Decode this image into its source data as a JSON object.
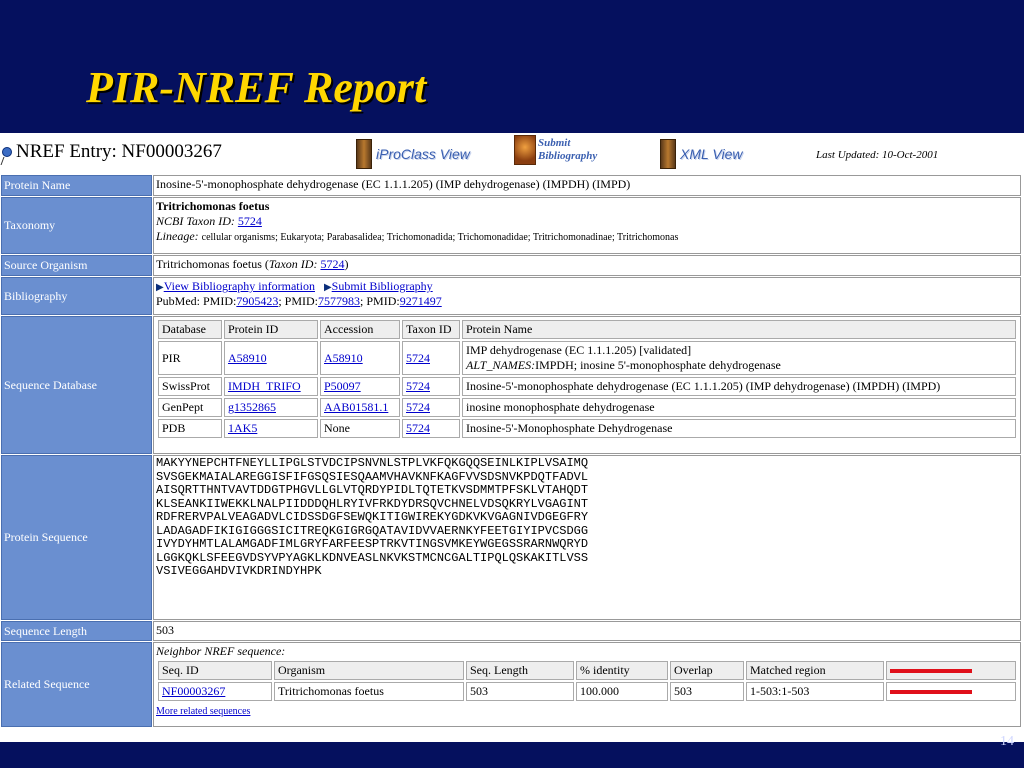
{
  "slide": {
    "title": "PIR-NREF Report",
    "page_number": "14"
  },
  "header": {
    "entry_label": "NREF Entry: NF00003267",
    "iproclass_label": "iProClass View",
    "submit_label_line1": "Submit",
    "submit_label_line2": "Bibliography",
    "xml_label": "XML View",
    "last_updated": "Last Updated: 10-Oct-2001"
  },
  "labels": {
    "protein_name": "Protein Name",
    "taxonomy": "Taxonomy",
    "source_organism": "Source Organism",
    "bibliography": "Bibliography",
    "sequence_database": "Sequence Database",
    "protein_sequence": "Protein Sequence",
    "sequence_length": "Sequence Length",
    "related_sequence": "Related Sequence"
  },
  "protein_name": "Inosine-5'-monophosphate dehydrogenase (EC 1.1.1.205) (IMP dehydrogenase) (IMPDH) (IMPD)",
  "taxonomy": {
    "name": "Tritrichomonas foetus",
    "ncbi_label": "NCBI Taxon ID:",
    "ncbi_id": "5724",
    "lineage_label": "Lineage:",
    "lineage": "cellular organisms; Eukaryota; Parabasalidea; Trichomonadida; Trichomonadidae; Tritrichomonadinae; Tritrichomonas"
  },
  "source_organism": {
    "prefix": "Tritrichomonas foetus (",
    "taxon_label": "Taxon ID:",
    "taxon_id": "5724",
    "suffix": ")"
  },
  "bibliography": {
    "view_link": "View Bibliography information",
    "submit_link": "Submit Bibliography",
    "pubmed_prefix": "PubMed: PMID:",
    "pmid1": "7905423",
    "sep1": "; PMID:",
    "pmid2": "7577983",
    "sep2": "; PMID:",
    "pmid3": "9271497"
  },
  "sequence_database": {
    "headers": [
      "Database",
      "Protein ID",
      "Accession",
      "Taxon ID",
      "Protein Name"
    ],
    "rows": [
      {
        "database": "PIR",
        "protein_id": "A58910",
        "accession": "A58910",
        "taxon_id": "5724",
        "name": "IMP dehydrogenase (EC 1.1.1.205) [validated]",
        "alt_label": "ALT_NAMES:",
        "alt_names": "IMPDH; inosine 5'-monophosphate dehydrogenase"
      },
      {
        "database": "SwissProt",
        "protein_id": "IMDH_TRIFO",
        "accession": "P50097",
        "taxon_id": "5724",
        "name": "Inosine-5'-monophosphate dehydrogenase (EC 1.1.1.205) (IMP dehydrogenase) (IMPDH) (IMPD)"
      },
      {
        "database": "GenPept",
        "protein_id": "g1352865",
        "accession": "AAB01581.1",
        "taxon_id": "5724",
        "name": "inosine monophosphate dehydrogenase"
      },
      {
        "database": "PDB",
        "protein_id": "1AK5",
        "accession": "None",
        "taxon_id": "5724",
        "name": "Inosine-5'-Monophosphate Dehydrogenase"
      }
    ]
  },
  "protein_sequence": "MAKYYNEPCHTFNEYLLIPGLSTVDCIPSNVNLSTPLVKFQKGQQSEINLKIPLVSAIMQ\nSVSGEKMAIALAREGGISFIFGSQSIESQAAMVHAVKNFKAGFVVSDSNVKPDQTFADVL\nAISQRTTHNTVAVTDDGTPHGVLLGLVTQRDYPIDLTQTETKVSDMMTPFSKLVTAHQDT\nKLSEANKIIWEKKLNALPIIDDDQHLRYIVFRKDYDRSQVCHNELVDSQKRYLVGAGINT\nRDFRERVPALVEAGADVLCIDSSDGFSEWQKITIGWIREKYGDKVKVGAGNIVDGEGFRY\nLADAGADFIKIGIGGGSICITREQKGIGRGQATAVIDVVAERNKYFEETGIYIPVCSDGG\nIVYDYHMTLALAMGADFIMLGRYFARFEESPTRKVTINGSVMKEYWGEGSSRARNWQRYD\nLGGKQKLSFEEGVDSYVPYAGKLKDNVEASLNKVKSTMCNCGALTIPQLQSKAKITLVSS\nVSIVEGGAHDVIVKDRINDYHPK",
  "sequence_length": "503",
  "related": {
    "caption": "Neighbor NREF sequence:",
    "headers": [
      "Seq. ID",
      "Organism",
      "Seq. Length",
      "% identity",
      "Overlap",
      "Matched region"
    ],
    "rows": [
      {
        "seq_id": "NF00003267",
        "organism": "Tritrichomonas foetus",
        "length": "503",
        "identity": "100.000",
        "overlap": "503",
        "region": "1-503:1-503",
        "match_fraction": 1.0
      }
    ],
    "more_link": "More related sequences"
  },
  "colors": {
    "slide_bg": "#05105e",
    "title": "#ffd700",
    "label_bg": "#6a8fd0",
    "match_bar": "#e0101a"
  }
}
